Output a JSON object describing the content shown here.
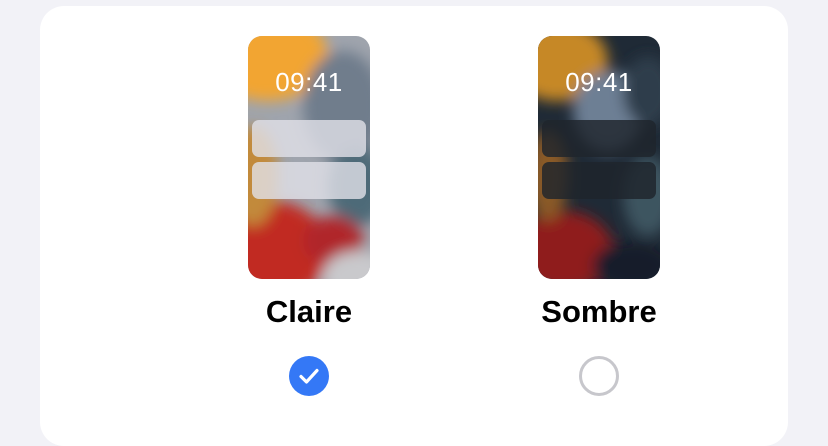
{
  "appearance": {
    "options": [
      {
        "label": "Claire",
        "time": "09:41",
        "selected": true,
        "theme": "light"
      },
      {
        "label": "Sombre",
        "time": "09:41",
        "selected": false,
        "theme": "dark"
      }
    ]
  },
  "colors": {
    "page_background": "#f2f2f7",
    "card_background": "#ffffff",
    "accent": "#3478f6",
    "radio_unselected": "#c7c7cc"
  },
  "icons": {
    "selected": "checkmark-icon",
    "unselected": "empty-circle-icon"
  }
}
